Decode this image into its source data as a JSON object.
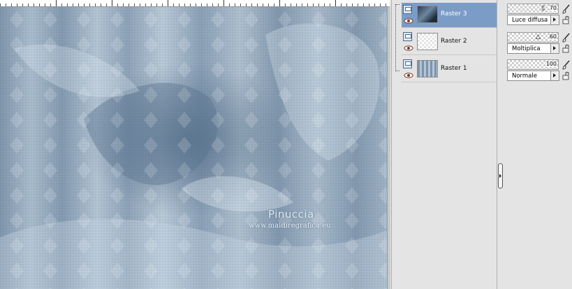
{
  "watermark": {
    "title": "Pinuccia",
    "url": "www.maidiregrafica.eu"
  },
  "colors": {
    "canvas_base": "#8fa4b8",
    "selected_layer": "#7b9cc6",
    "panel_bg": "#e4e4e4"
  },
  "layers": [
    {
      "name": "Raster 3",
      "selected": true,
      "thumb": "dark-flower"
    },
    {
      "name": "Raster 2",
      "selected": false,
      "thumb": "transparent"
    },
    {
      "name": "Raster 1",
      "selected": false,
      "thumb": "blue-stripes"
    }
  ],
  "properties": [
    {
      "opacity": "70",
      "blend_mode": "Luce diffusa"
    },
    {
      "opacity": "60",
      "blend_mode": "Moltiplica"
    },
    {
      "opacity": "100",
      "blend_mode": "Normale"
    }
  ],
  "icons": {
    "eye": "eye-icon",
    "layer_type": "raster-layer-icon",
    "brush": "paintbrush-icon",
    "lock": "lock-icon",
    "dropdown": "triangle-right-icon",
    "panel_handle": "collapse-handle-icon"
  }
}
